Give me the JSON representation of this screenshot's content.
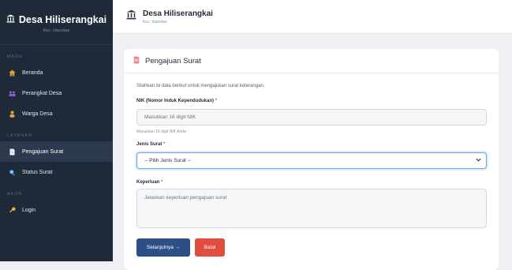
{
  "sidebar": {
    "title": "Desa Hiliserangkai",
    "subtitle": "Kec. Idanotae",
    "sections": {
      "menu": "MENU",
      "layanan": "LAYANAN",
      "akun": "AKUN"
    },
    "items": [
      {
        "label": "Beranda",
        "icon": "house-icon"
      },
      {
        "label": "Perangkat Desa",
        "icon": "group-icon"
      },
      {
        "label": "Warga Desa",
        "icon": "person-icon"
      },
      {
        "label": "Pengajuan Surat",
        "icon": "document-icon"
      },
      {
        "label": "Status Surat",
        "icon": "search-icon"
      },
      {
        "label": "Login",
        "icon": "key-icon"
      }
    ]
  },
  "header": {
    "title": "Desa Hiliserangkai",
    "subtitle": "Kec. Idanotae"
  },
  "card": {
    "title": "Pengajuan Surat",
    "description": "Silahkan isi data berikut untuk mengajukan surat keterangan.",
    "nik": {
      "label": "NIK (Nomor Induk Kependudukan)",
      "placeholder": "Masukkan 16 digit NIK",
      "hint": "Masukkan 16 digit NIK Anda"
    },
    "jenis": {
      "label": "Jenis Surat",
      "selected": "-- Pilih Jenis Surat --"
    },
    "keperluan": {
      "label": "Keperluan",
      "placeholder": "Jelaskan keperluan pengajuan surat"
    },
    "required_mark": "*",
    "next_label": "Selanjutnya →",
    "cancel_label": "Batal"
  },
  "colors": {
    "sidebar_bg": "#1f2a38",
    "primary": "#2d4f87",
    "danger": "#e14d3f",
    "focus": "#6fa3e6"
  }
}
